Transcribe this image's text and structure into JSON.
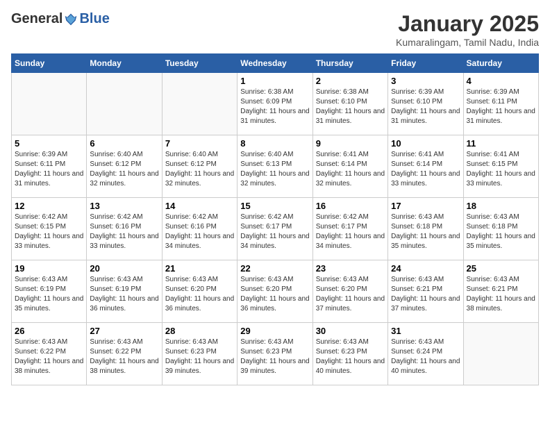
{
  "logo": {
    "general": "General",
    "blue": "Blue"
  },
  "title": "January 2025",
  "location": "Kumaralingam, Tamil Nadu, India",
  "weekdays": [
    "Sunday",
    "Monday",
    "Tuesday",
    "Wednesday",
    "Thursday",
    "Friday",
    "Saturday"
  ],
  "weeks": [
    [
      {
        "day": "",
        "empty": true
      },
      {
        "day": "",
        "empty": true
      },
      {
        "day": "",
        "empty": true
      },
      {
        "day": "1",
        "sunrise": "6:38 AM",
        "sunset": "6:09 PM",
        "daylight": "11 hours and 31 minutes."
      },
      {
        "day": "2",
        "sunrise": "6:38 AM",
        "sunset": "6:10 PM",
        "daylight": "11 hours and 31 minutes."
      },
      {
        "day": "3",
        "sunrise": "6:39 AM",
        "sunset": "6:10 PM",
        "daylight": "11 hours and 31 minutes."
      },
      {
        "day": "4",
        "sunrise": "6:39 AM",
        "sunset": "6:11 PM",
        "daylight": "11 hours and 31 minutes."
      }
    ],
    [
      {
        "day": "5",
        "sunrise": "6:39 AM",
        "sunset": "6:11 PM",
        "daylight": "11 hours and 31 minutes."
      },
      {
        "day": "6",
        "sunrise": "6:40 AM",
        "sunset": "6:12 PM",
        "daylight": "11 hours and 32 minutes."
      },
      {
        "day": "7",
        "sunrise": "6:40 AM",
        "sunset": "6:12 PM",
        "daylight": "11 hours and 32 minutes."
      },
      {
        "day": "8",
        "sunrise": "6:40 AM",
        "sunset": "6:13 PM",
        "daylight": "11 hours and 32 minutes."
      },
      {
        "day": "9",
        "sunrise": "6:41 AM",
        "sunset": "6:14 PM",
        "daylight": "11 hours and 32 minutes."
      },
      {
        "day": "10",
        "sunrise": "6:41 AM",
        "sunset": "6:14 PM",
        "daylight": "11 hours and 33 minutes."
      },
      {
        "day": "11",
        "sunrise": "6:41 AM",
        "sunset": "6:15 PM",
        "daylight": "11 hours and 33 minutes."
      }
    ],
    [
      {
        "day": "12",
        "sunrise": "6:42 AM",
        "sunset": "6:15 PM",
        "daylight": "11 hours and 33 minutes."
      },
      {
        "day": "13",
        "sunrise": "6:42 AM",
        "sunset": "6:16 PM",
        "daylight": "11 hours and 33 minutes."
      },
      {
        "day": "14",
        "sunrise": "6:42 AM",
        "sunset": "6:16 PM",
        "daylight": "11 hours and 34 minutes."
      },
      {
        "day": "15",
        "sunrise": "6:42 AM",
        "sunset": "6:17 PM",
        "daylight": "11 hours and 34 minutes."
      },
      {
        "day": "16",
        "sunrise": "6:42 AM",
        "sunset": "6:17 PM",
        "daylight": "11 hours and 34 minutes."
      },
      {
        "day": "17",
        "sunrise": "6:43 AM",
        "sunset": "6:18 PM",
        "daylight": "11 hours and 35 minutes."
      },
      {
        "day": "18",
        "sunrise": "6:43 AM",
        "sunset": "6:18 PM",
        "daylight": "11 hours and 35 minutes."
      }
    ],
    [
      {
        "day": "19",
        "sunrise": "6:43 AM",
        "sunset": "6:19 PM",
        "daylight": "11 hours and 35 minutes."
      },
      {
        "day": "20",
        "sunrise": "6:43 AM",
        "sunset": "6:19 PM",
        "daylight": "11 hours and 36 minutes."
      },
      {
        "day": "21",
        "sunrise": "6:43 AM",
        "sunset": "6:20 PM",
        "daylight": "11 hours and 36 minutes."
      },
      {
        "day": "22",
        "sunrise": "6:43 AM",
        "sunset": "6:20 PM",
        "daylight": "11 hours and 36 minutes."
      },
      {
        "day": "23",
        "sunrise": "6:43 AM",
        "sunset": "6:20 PM",
        "daylight": "11 hours and 37 minutes."
      },
      {
        "day": "24",
        "sunrise": "6:43 AM",
        "sunset": "6:21 PM",
        "daylight": "11 hours and 37 minutes."
      },
      {
        "day": "25",
        "sunrise": "6:43 AM",
        "sunset": "6:21 PM",
        "daylight": "11 hours and 38 minutes."
      }
    ],
    [
      {
        "day": "26",
        "sunrise": "6:43 AM",
        "sunset": "6:22 PM",
        "daylight": "11 hours and 38 minutes."
      },
      {
        "day": "27",
        "sunrise": "6:43 AM",
        "sunset": "6:22 PM",
        "daylight": "11 hours and 38 minutes."
      },
      {
        "day": "28",
        "sunrise": "6:43 AM",
        "sunset": "6:23 PM",
        "daylight": "11 hours and 39 minutes."
      },
      {
        "day": "29",
        "sunrise": "6:43 AM",
        "sunset": "6:23 PM",
        "daylight": "11 hours and 39 minutes."
      },
      {
        "day": "30",
        "sunrise": "6:43 AM",
        "sunset": "6:23 PM",
        "daylight": "11 hours and 40 minutes."
      },
      {
        "day": "31",
        "sunrise": "6:43 AM",
        "sunset": "6:24 PM",
        "daylight": "11 hours and 40 minutes."
      },
      {
        "day": "",
        "empty": true
      }
    ]
  ]
}
